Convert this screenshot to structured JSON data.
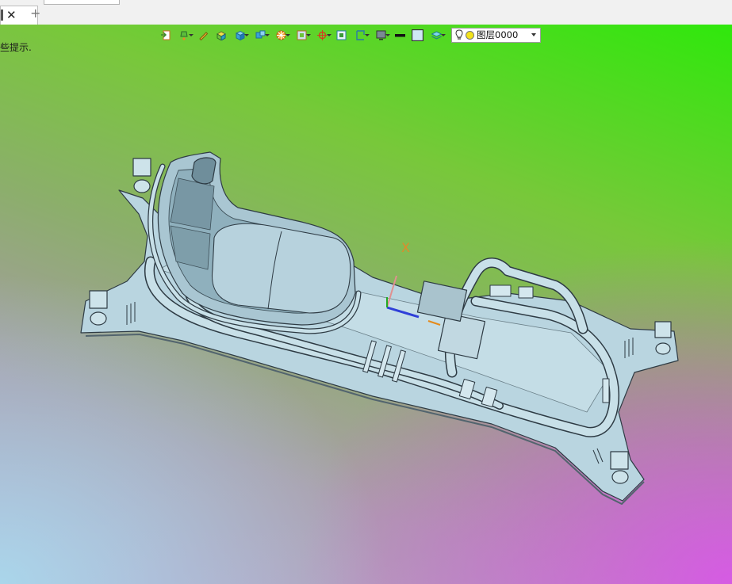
{
  "tab": {
    "close_icon": "close-icon",
    "add_icon": "plus-icon"
  },
  "statusbar": {
    "hint_text": "些提示."
  },
  "toolbar": {
    "layer_combo": {
      "value": "图层0000",
      "bulb_icon": "lightbulb-icon",
      "color_swatch": "#f2e21c"
    }
  },
  "viewport": {
    "triad_axis_label": "X",
    "background_colors": [
      "#2fe80c",
      "#8cae6c",
      "#d452e2",
      "#a5d7eb"
    ],
    "model_color": "#b9d5e0"
  }
}
